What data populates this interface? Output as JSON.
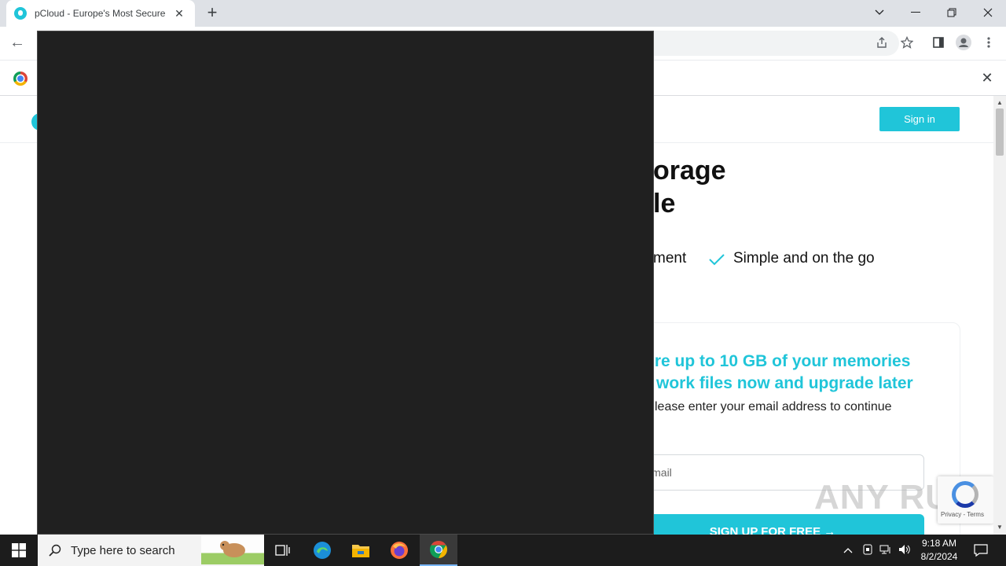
{
  "browser": {
    "tab_title": "pCloud - Europe's Most Secure C",
    "tab_close": "✕",
    "new_tab": "+",
    "window_controls": [
      "chevron-down-icon",
      "minimize-icon",
      "restore-icon",
      "close-icon"
    ]
  },
  "toolbar": {
    "back": "←",
    "icons": [
      "share-icon",
      "star-icon",
      "side-panel-icon",
      "profile-icon",
      "menu-icon"
    ]
  },
  "infobar": {
    "close": "✕"
  },
  "site": {
    "brand_color": "#20c5d9",
    "sign_in": "Sign in",
    "hero_line1": "orage",
    "hero_line2": "le",
    "feature_partial": "ment",
    "feature_2": "Simple and on the go",
    "card_title_1": "ore up to 10 GB of your memories",
    "card_title_2": "work files now and upgrade later",
    "card_sub": "lease enter your email address to continue",
    "email_placeholder": "ur email",
    "signup": "SIGN UP FOR FREE →",
    "recaptcha_links": "Privacy - Terms",
    "watermark": "ANY RUN"
  },
  "overlay": {
    "color": "#202020"
  },
  "taskbar": {
    "search_placeholder": "Type here to search",
    "apps": [
      "task-view-icon",
      "edge-icon",
      "file-explorer-icon",
      "firefox-icon",
      "chrome-icon"
    ],
    "tray_chevron": "^",
    "time": "9:18 AM",
    "date": "8/2/2024"
  }
}
